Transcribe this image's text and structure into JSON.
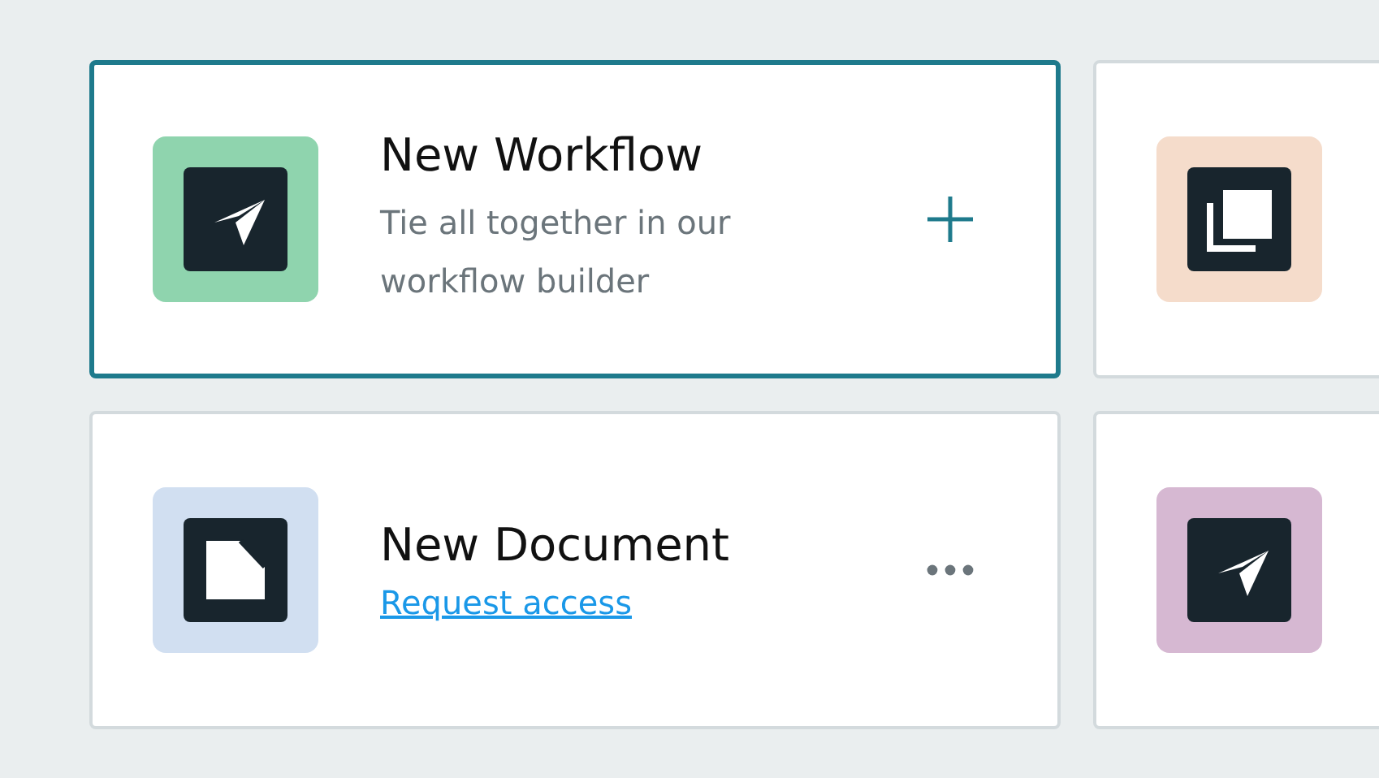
{
  "cards": [
    {
      "kind": "send",
      "color": "#8fd4ae",
      "title": "New Workflow",
      "subtitle": "Tie all together in our workflow builder",
      "action": {
        "kind": "add"
      },
      "selected": true
    },
    {
      "kind": "copy",
      "color": "#f5dccb",
      "selected": false
    },
    {
      "kind": "document",
      "color": "#d1dff1",
      "title": "New Document",
      "link": "Request access",
      "action": {
        "kind": "more"
      },
      "selected": false
    },
    {
      "kind": "send",
      "color": "#d6b8d2",
      "selected": false
    }
  ]
}
